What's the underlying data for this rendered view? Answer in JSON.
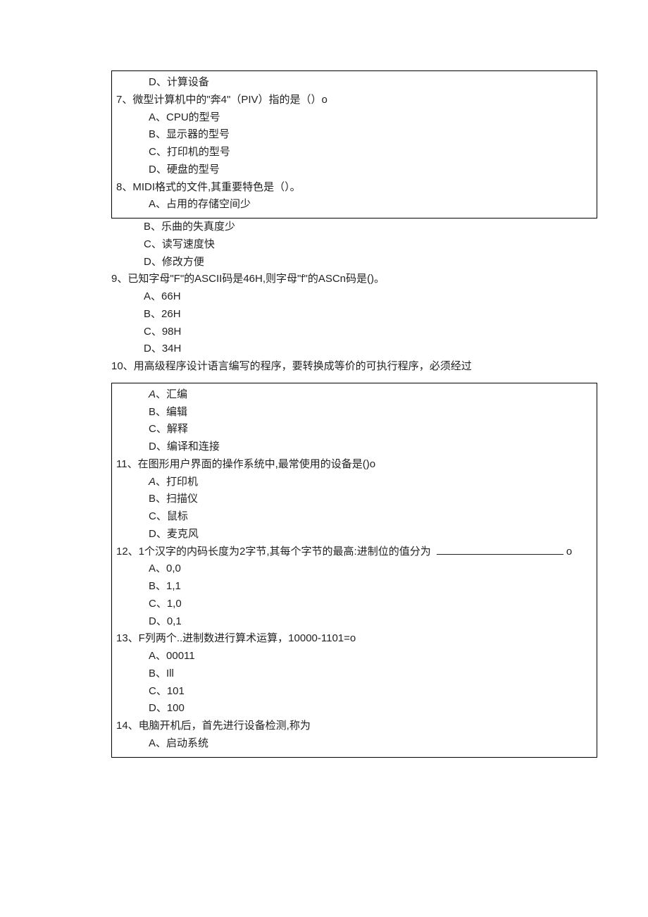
{
  "top_box": {
    "q6_option_d": "D、计算设备",
    "q7": "7、微型计算机中的\"奔4\"（PIV）指的是（）o",
    "q7_a": "A、CPU的型号",
    "q7_b": "B、显示器的型号",
    "q7_c": "C、打印机的型号",
    "q7_d": "D、硬盘的型号",
    "q8": "8、MIDI格式的文件,其重要特色是（）。",
    "q8_a": "A、占用的存储空间少"
  },
  "mid_open": {
    "q8_b": "B、乐曲的失真度少",
    "q8_c": "C、读写速度快",
    "q8_d": "D、修改方便",
    "q9": "9、已知字母\"F\"的ASCII码是46H,则字母\"f\"的ASCn码是()。",
    "q9_a": "A、66H",
    "q9_b": "B、26H",
    "q9_c": "C、98H",
    "q9_d": "D、34H",
    "q10": "10、用高级程序设计语言编写的程序，要转换成等价的可执行程序，必须经过"
  },
  "bottom_box": {
    "q10_a_prefix": "A",
    "q10_a_rest": "、汇编",
    "q10_b": "B、编辑",
    "q10_c": "C、解释",
    "q10_d": "D、编译和连接",
    "q11": "11、在图形用户界面的操作系统中,最常使用的设备是()o",
    "q11_a_prefix": "A",
    "q11_a_rest": "、打印机",
    "q11_b": "B、扫描仪",
    "q11_c": "C、鼠标",
    "q11_d": "D、麦克风",
    "q12_pre": "12、1个汉字的内码长度为2字节,其每个字节的最高:进制位的值分为 ",
    "q12_suf": "o",
    "q12_a": "A、0,0",
    "q12_b": "B、1,1",
    "q12_c": "C、1,0",
    "q12_d": "D、0,1",
    "q13": "13、F列两个..进制数进行算术运算，10000-1101=o",
    "q13_a": "A、00011",
    "q13_b": "B、Ill",
    "q13_c": "C、101",
    "q13_d": "D、100",
    "q14": "14、电脑开机后，首先进行设备检测,称为",
    "q14_a": "A、启动系统"
  }
}
